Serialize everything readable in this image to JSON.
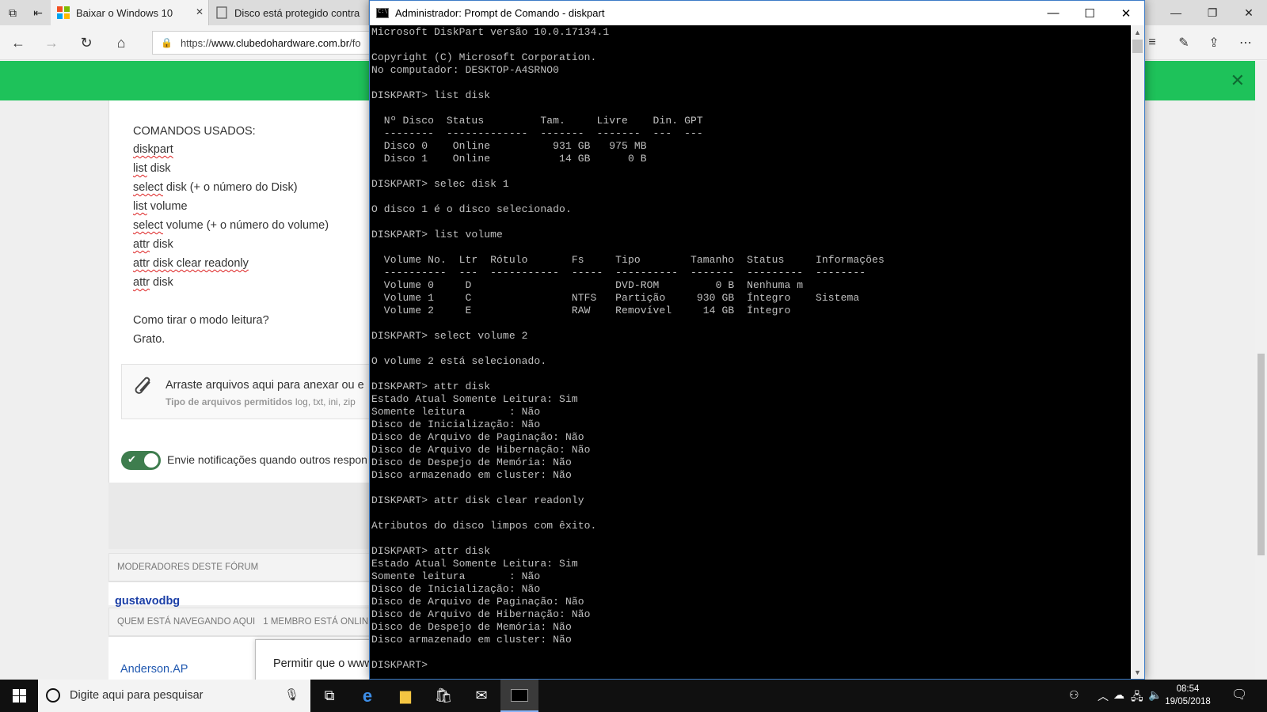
{
  "browser": {
    "tabs": [
      {
        "title": "Baixar o Windows 10"
      },
      {
        "title": "Disco está protegido contra"
      }
    ],
    "address": {
      "prefix": "https://",
      "domain": "www.clubedohardware.com.br",
      "path": "/fo"
    },
    "close_symbol": "✕"
  },
  "post": {
    "heading": "COMANDOS USADOS:",
    "commands": [
      {
        "word": "diskpart",
        "rest": ""
      },
      {
        "word": "list",
        "rest": " disk"
      },
      {
        "word": "select",
        "rest": " disk (+ o número do Disk)"
      },
      {
        "word": "list",
        "rest": " volume"
      },
      {
        "word": "select",
        "rest": " volume (+ o número do volume)"
      },
      {
        "word": "attr",
        "rest": " disk"
      },
      {
        "word": "attr",
        "rest": " disk clear readonly"
      },
      {
        "word": "attr",
        "rest": " disk"
      }
    ],
    "question": "Como tirar o modo leitura?",
    "thanks": "Grato."
  },
  "attach": {
    "text": "Arraste arquivos aqui para anexar ou e",
    "types_label": "Tipo de arquivos permitidos",
    "types": " log, txt, ini, zip"
  },
  "notify": {
    "label": "Envie notificações quando outros respon"
  },
  "moderators": {
    "header": "MODERADORES DESTE FÓRUM",
    "name": "gustavodbg"
  },
  "browsing": {
    "header": "QUEM ESTÁ NAVEGANDO AQUI",
    "count": "1 MEMBRO ESTÁ ONLIN",
    "member": "Anderson.AP"
  },
  "popup": {
    "text": "Permitir que o www"
  },
  "cmd": {
    "title": "Administrador: Prompt de Comando - diskpart",
    "output": "Microsoft DiskPart versão 10.0.17134.1\n\nCopyright (C) Microsoft Corporation.\nNo computador: DESKTOP-A4SRNO0\n\nDISKPART> list disk\n\n  Nº Disco  Status         Tam.     Livre    Din. GPT\n  --------  -------------  -------  -------  ---  ---\n  Disco 0    Online          931 GB   975 MB\n  Disco 1    Online           14 GB      0 B\n\nDISKPART> selec disk 1\n\nO disco 1 é o disco selecionado.\n\nDISKPART> list volume\n\n  Volume No.  Ltr  Rótulo       Fs     Tipo        Tamanho  Status     Informações\n  ----------  ---  -----------  -----  ----------  -------  ---------  --------\n  Volume 0     D                       DVD-ROM         0 B  Nenhuma m\n  Volume 1     C                NTFS   Partição     930 GB  Íntegro    Sistema\n  Volume 2     E                RAW    Removível     14 GB  Íntegro\n\nDISKPART> select volume 2\n\nO volume 2 está selecionado.\n\nDISKPART> attr disk\nEstado Atual Somente Leitura: Sim\nSomente leitura       : Não\nDisco de Inicialização: Não\nDisco de Arquivo de Paginação: Não\nDisco de Arquivo de Hibernação: Não\nDisco de Despejo de Memória: Não\nDisco armazenado em cluster: Não\n\nDISKPART> attr disk clear readonly\n\nAtributos do disco limpos com êxito.\n\nDISKPART> attr disk\nEstado Atual Somente Leitura: Sim\nSomente leitura       : Não\nDisco de Inicialização: Não\nDisco de Arquivo de Paginação: Não\nDisco de Arquivo de Hibernação: Não\nDisco de Despejo de Memória: Não\nDisco armazenado em cluster: Não\n\nDISKPART>"
  },
  "taskbar": {
    "search_placeholder": "Digite aqui para pesquisar",
    "time": "08:54",
    "date": "19/05/2018"
  },
  "colors": {
    "banner_green": "#1ec25a",
    "link_blue": "#1a3ea6",
    "toggle_green": "#3e7d4e"
  }
}
